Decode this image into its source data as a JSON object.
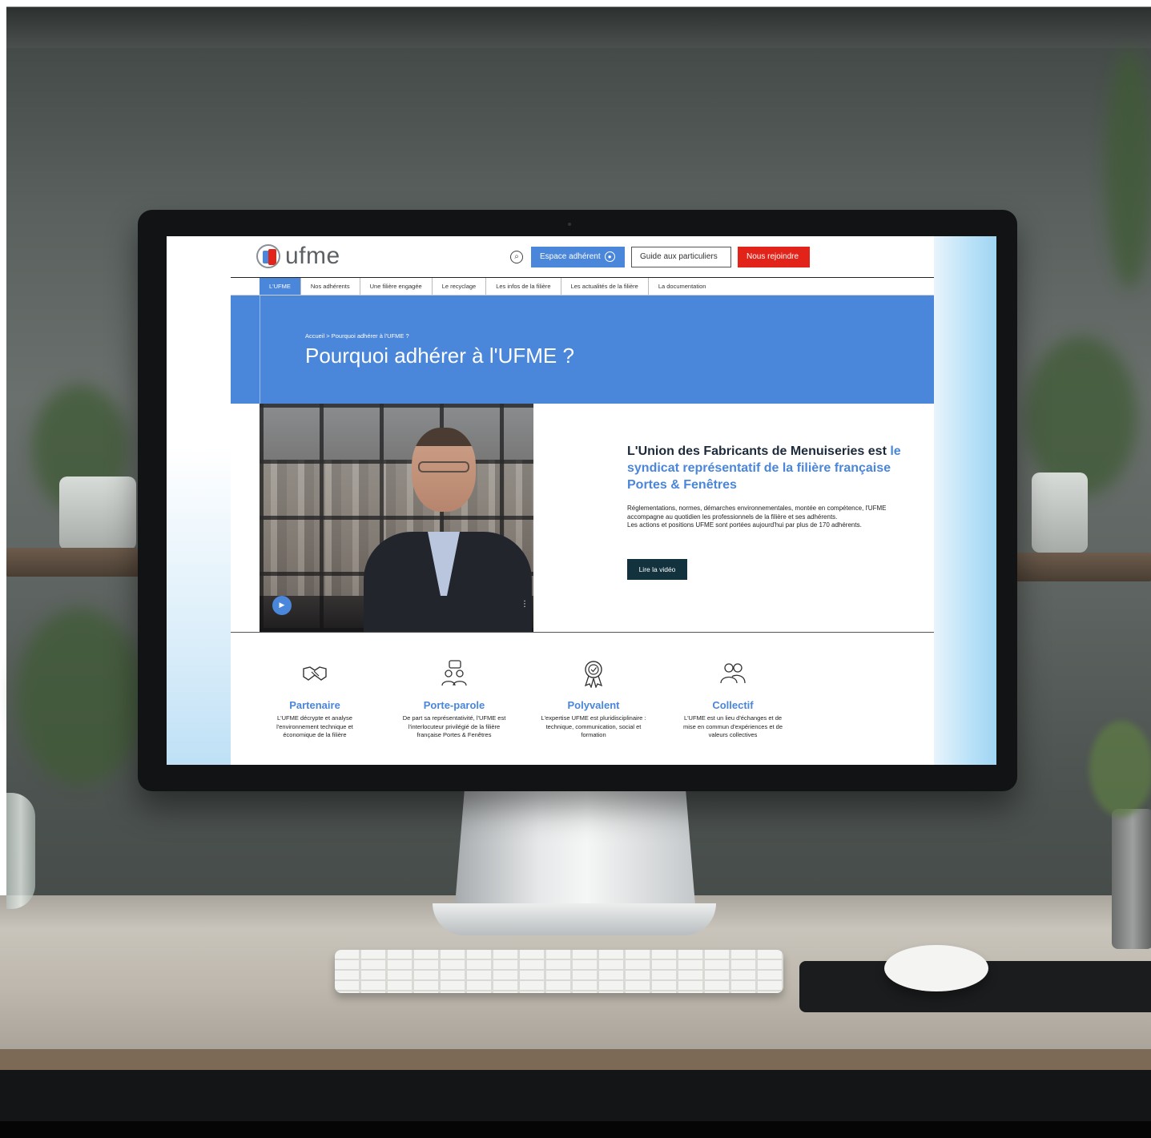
{
  "header": {
    "logo_text": "ufme",
    "search_icon": "search-icon",
    "espace_label": "Espace adhérent",
    "guide_label": "Guide aux particuliers",
    "rejoindre_label": "Nous rejoindre",
    "colors": {
      "brand_blue": "#4a86d9",
      "brand_red": "#e2231a",
      "dark_button": "#12323e"
    }
  },
  "nav": {
    "items": [
      {
        "label": "L'UFME"
      },
      {
        "label": "Nos adhérents"
      },
      {
        "label": "Une filière engagée"
      },
      {
        "label": "Le recyclage"
      },
      {
        "label": "Les infos de la filière"
      },
      {
        "label": "Les actualités de la filière"
      },
      {
        "label": "La documentation"
      }
    ]
  },
  "hero": {
    "breadcrumb": "Accueil  >  Pourquoi adhérer à l'UFME ?",
    "title": "Pourquoi adhérer à l'UFME ?"
  },
  "intro": {
    "heading_dark": "L'Union des Fabricants de Menuiseries est",
    "heading_blue": "le syndicat représentatif de la filière française Portes & Fenêtres",
    "paragraph_1": "Réglementations, normes, démarches environnementales, montée en compétence, l'UFME accompagne au quotidien les professionnels de la filière et ses adhérents.",
    "paragraph_2": "Les actions et positions UFME sont portées aujourd'hui par plus de 170 adhérents.",
    "button_label": "Lire la vidéo"
  },
  "features": [
    {
      "icon": "handshake-icon",
      "title": "Partenaire",
      "text": "L'UFME décrypte et analyse l'environnement technique et économique de la filière"
    },
    {
      "icon": "people-chat-icon",
      "title": "Porte-parole",
      "text": "De part sa représentativité, l'UFME est l'interlocuteur privilégié de la filière française Portes & Fenêtres"
    },
    {
      "icon": "award-badge-icon",
      "title": "Polyvalent",
      "text": "L'expertise UFME est pluridisciplinaire : technique, communication, social et formation"
    },
    {
      "icon": "group-icon",
      "title": "Collectif",
      "text": "L'UFME est un lieu d'échanges et de mise en commun d'expériences et de valeurs collectives"
    }
  ]
}
